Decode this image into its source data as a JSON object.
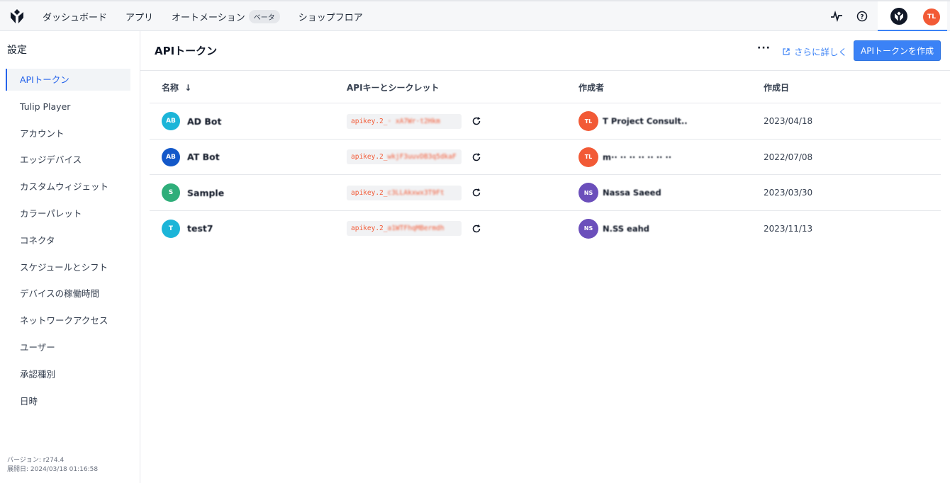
{
  "nav": {
    "items": [
      {
        "label": "ダッシュボード"
      },
      {
        "label": "アプリ"
      },
      {
        "label": "オートメーション",
        "badge": "ベータ"
      },
      {
        "label": "ショップフロア"
      }
    ],
    "icons": [
      "pulse-icon",
      "help-icon",
      "tulip-logo-icon"
    ],
    "user_initials": "TL"
  },
  "sidebar": {
    "title": "設定",
    "items": [
      {
        "label": "APIトークン",
        "active": true
      },
      {
        "label": "Tulip Player"
      },
      {
        "label": "アカウント"
      },
      {
        "label": "エッジデバイス"
      },
      {
        "label": "カスタムウィジェット"
      },
      {
        "label": "カラーパレット"
      },
      {
        "label": "コネクタ"
      },
      {
        "label": "スケジュールとシフト"
      },
      {
        "label": "デバイスの稼働時間"
      },
      {
        "label": "ネットワークアクセス"
      },
      {
        "label": "ユーザー"
      },
      {
        "label": "承認種別"
      },
      {
        "label": "日時"
      }
    ],
    "version": "バージョン: r274.4",
    "deployed": "展開日: 2024/03/18 01:16:58"
  },
  "header": {
    "title": "APIトークン",
    "more": "···",
    "learn_more": "さらに詳しく",
    "create_button": "APIトークンを作成"
  },
  "table": {
    "columns": [
      "名称",
      "APIキーとシークレット",
      "作成者",
      "作成日"
    ],
    "sort_indicator": "↓",
    "rows": [
      {
        "initials": "AB",
        "avatar_color": "#1cb5d8",
        "name": "AD Bot",
        "key_prefix": "apikey.2_",
        "key_rest": "· xA7Wr·t2Hkm",
        "creator": "T Project Consult..",
        "creator_initials": "TL",
        "creator_color": "#f25a36",
        "date": "2023/04/18"
      },
      {
        "initials": "AB",
        "avatar_color": "#1358c9",
        "name": "AT Bot",
        "key_prefix": "apikey.2_",
        "key_rest": "wkjF3uuvDB3q5dkaF",
        "creator": "m·· ·· ·· ·· ·· ·· ··",
        "creator_initials": "TL",
        "creator_color": "#f25a36",
        "date": "2022/07/08"
      },
      {
        "initials": "S",
        "avatar_color": "#2fae7a",
        "name": "Sample",
        "key_prefix": "apikey.2_",
        "key_rest": "c3LLAkxwx3T9Ft",
        "creator": "Nassa Saeed",
        "creator_initials": "NS",
        "creator_color": "#6b4fbb",
        "date": "2023/03/30"
      },
      {
        "initials": "T",
        "avatar_color": "#1cb5d8",
        "name": "test7",
        "key_prefix": "apikey.2_",
        "key_rest": "a1WTFhqMBermdh",
        "creator": "N.SS eahd",
        "creator_initials": "NS",
        "creator_color": "#6b4fbb",
        "date": "2023/11/13"
      }
    ]
  }
}
